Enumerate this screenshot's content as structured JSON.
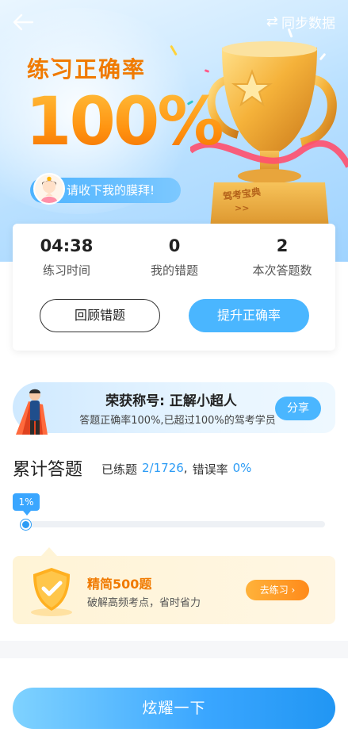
{
  "header": {
    "sync_label": "同步数据"
  },
  "hero": {
    "title": "练习正确率",
    "rate": "100%",
    "bow_text": "请收下我的膜拜!",
    "trophy_plate_text": "驾考宝典",
    "trophy_plate_arrows": ">>"
  },
  "stats": {
    "items": [
      {
        "value": "04:38",
        "label": "练习时间"
      },
      {
        "value": "0",
        "label": "我的错题"
      },
      {
        "value": "2",
        "label": "本次答题数"
      }
    ],
    "review_button": "回顾错题",
    "improve_button": "提升正确率"
  },
  "honor": {
    "title": "荣获称号: 正解小超人",
    "desc": "答题正确率100%,已超过100%的驾考学员",
    "share_button": "分享"
  },
  "cumulative": {
    "title": "累计答题",
    "done_label": "已练题",
    "done_value": "2/1726",
    "sep": ",",
    "error_label": "错误率",
    "error_value": "0%",
    "progress_label": "1%",
    "progress_value": 0.01
  },
  "promo": {
    "title": "精简500题",
    "desc": "破解高频考点，省时省力",
    "button": "去练习 ›"
  },
  "cta": {
    "label": "炫耀一下"
  },
  "colors": {
    "accent_blue": "#3aa6ff",
    "accent_orange": "#f07a00"
  }
}
